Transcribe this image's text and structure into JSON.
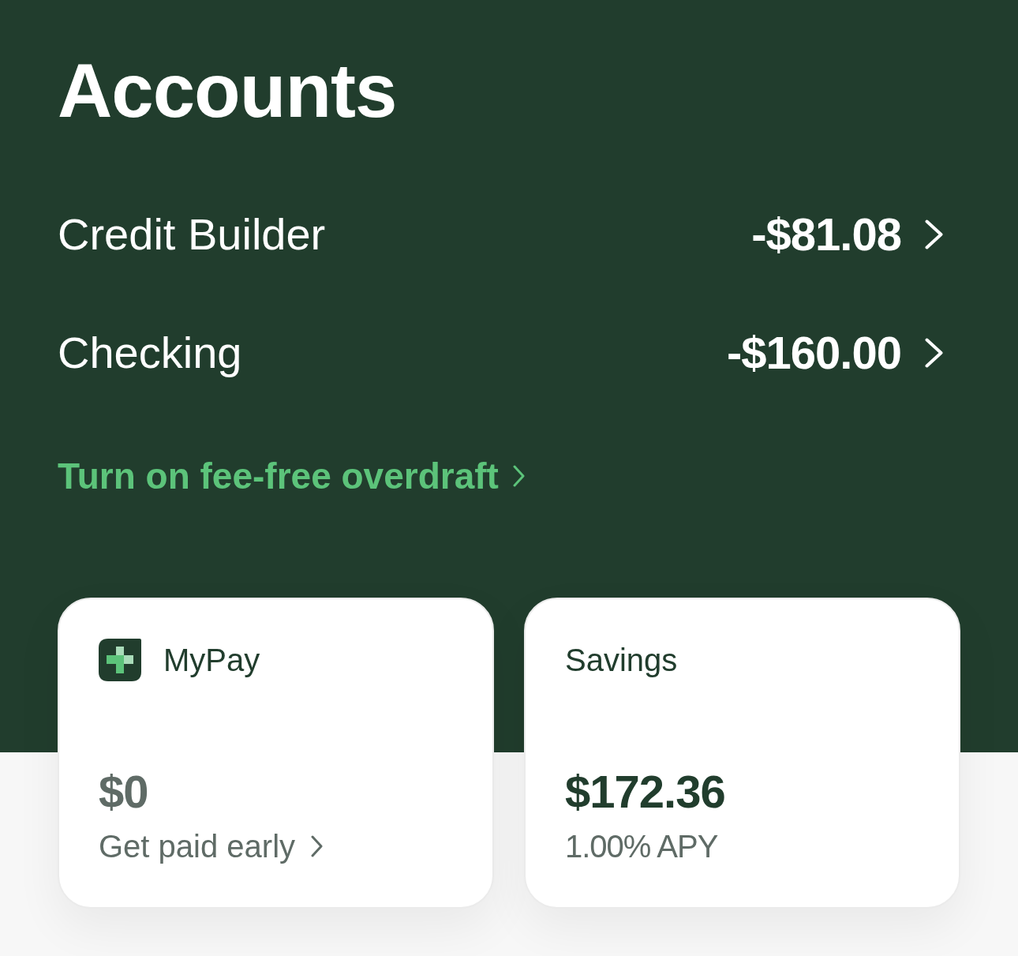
{
  "header": {
    "title": "Accounts"
  },
  "accounts": [
    {
      "name": "Credit Builder",
      "amount": "-$81.08"
    },
    {
      "name": "Checking",
      "amount": "-$160.00"
    }
  ],
  "overdraft_link": {
    "label": "Turn on fee-free overdraft"
  },
  "cards": [
    {
      "kind": "mypay",
      "title": "MyPay",
      "amount": "$0",
      "subtitle": "Get paid early"
    },
    {
      "kind": "savings",
      "title": "Savings",
      "amount": "$172.36",
      "subtitle": "1.00% APY"
    }
  ]
}
